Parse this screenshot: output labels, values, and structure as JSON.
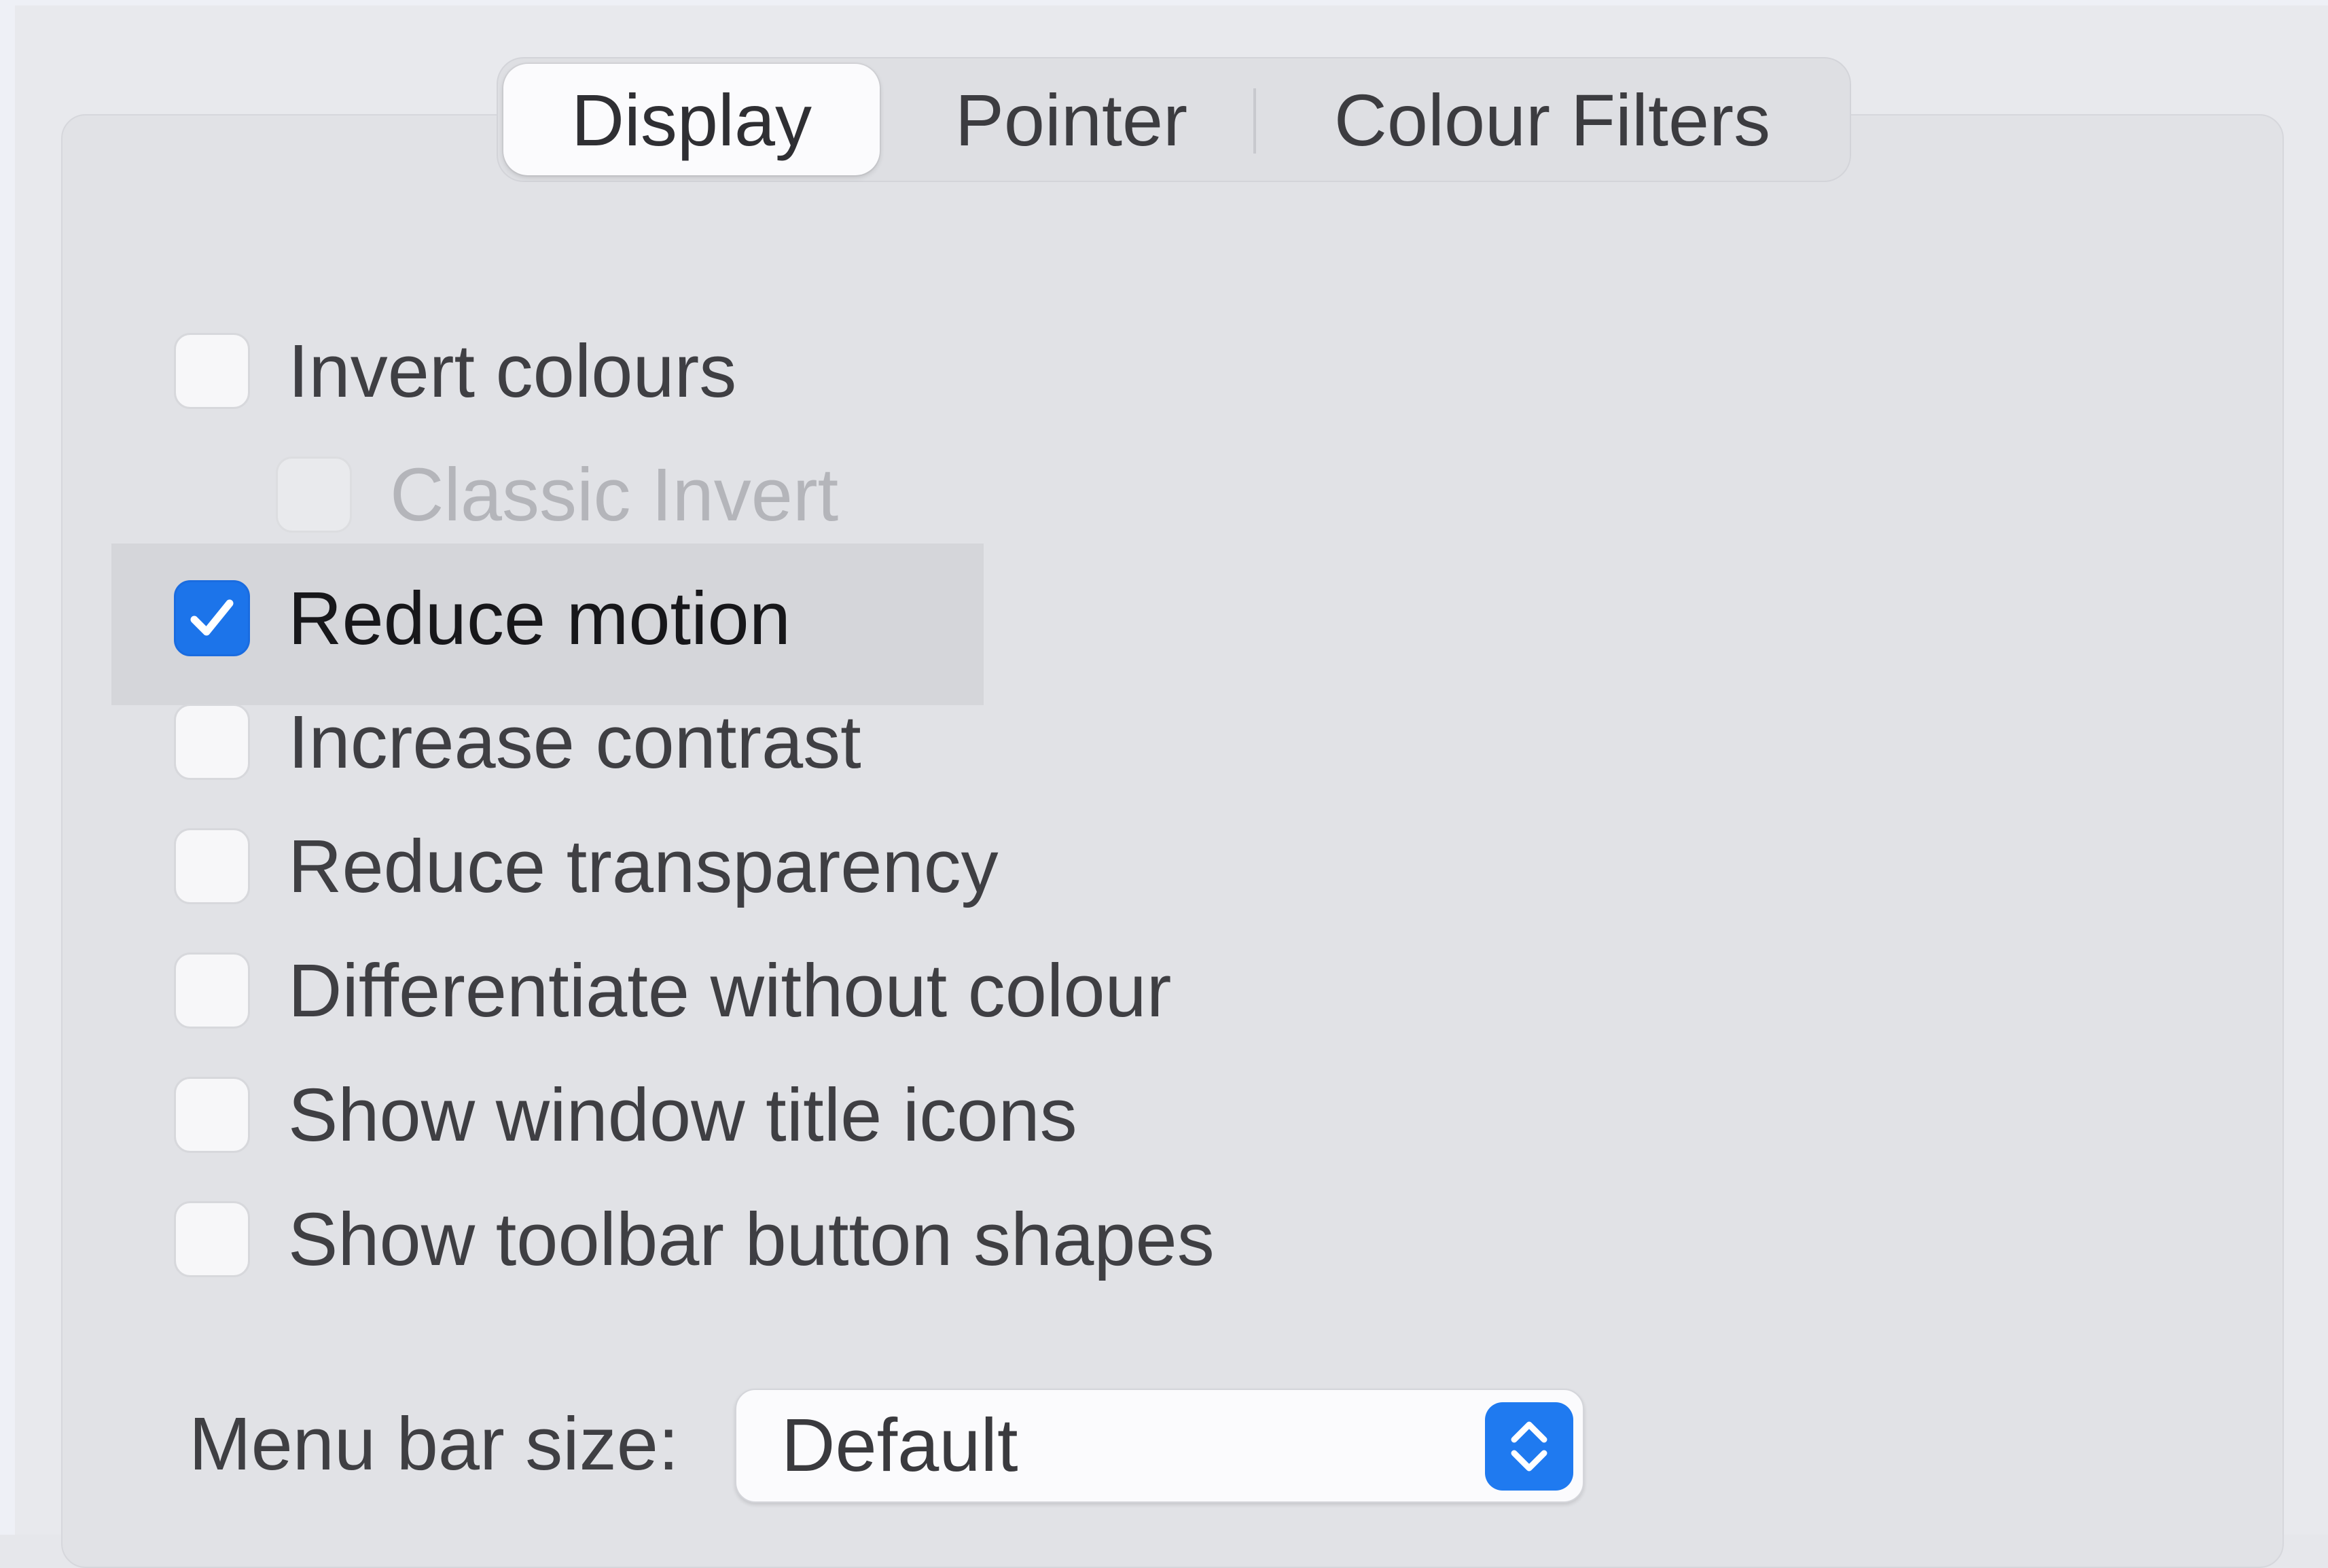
{
  "tabs": [
    {
      "label": "Display",
      "selected": true
    },
    {
      "label": "Pointer",
      "selected": false
    },
    {
      "label": "Colour Filters",
      "selected": false
    }
  ],
  "options": {
    "invert_colours": {
      "label": "Invert colours",
      "checked": false,
      "enabled": true
    },
    "classic_invert": {
      "label": "Classic Invert",
      "checked": false,
      "enabled": false
    },
    "reduce_motion": {
      "label": "Reduce motion",
      "checked": true,
      "enabled": true,
      "focused": true
    },
    "increase_contrast": {
      "label": "Increase contrast",
      "checked": false,
      "enabled": true
    },
    "reduce_transparency": {
      "label": "Reduce transparency",
      "checked": false,
      "enabled": true
    },
    "differentiate_without_colour": {
      "label": "Differentiate without colour",
      "checked": false,
      "enabled": true
    },
    "show_window_title_icons": {
      "label": "Show window title icons",
      "checked": false,
      "enabled": true
    },
    "show_toolbar_button_shapes": {
      "label": "Show toolbar button shapes",
      "checked": false,
      "enabled": true
    }
  },
  "menu_bar_size": {
    "label": "Menu bar size:",
    "value": "Default"
  },
  "icons": {
    "checkmark": "checkmark-icon",
    "stepper": "up-down-chevron-icon"
  },
  "colors": {
    "accent": "#1c74ea",
    "background": "#e1e2e6",
    "text": "#3f3f43",
    "disabled_text": "#b4b5ba"
  }
}
